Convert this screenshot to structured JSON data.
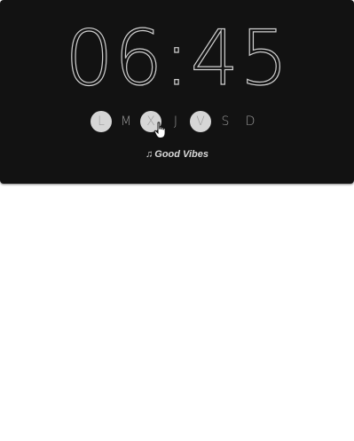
{
  "alarm": {
    "hours": "06",
    "separator": ":",
    "minutes": "45"
  },
  "days": [
    {
      "label": "L",
      "active": true
    },
    {
      "label": "M",
      "active": false
    },
    {
      "label": "X",
      "active": true
    },
    {
      "label": "J",
      "active": false
    },
    {
      "label": "V",
      "active": true
    },
    {
      "label": "S",
      "active": false
    },
    {
      "label": "D",
      "active": false
    }
  ],
  "song": {
    "icon": "music-note-icon",
    "title": "Good Vibes"
  },
  "colors": {
    "card_background": "#121212",
    "text": "#cfcfcf",
    "active_day": "#d6d6d6"
  }
}
